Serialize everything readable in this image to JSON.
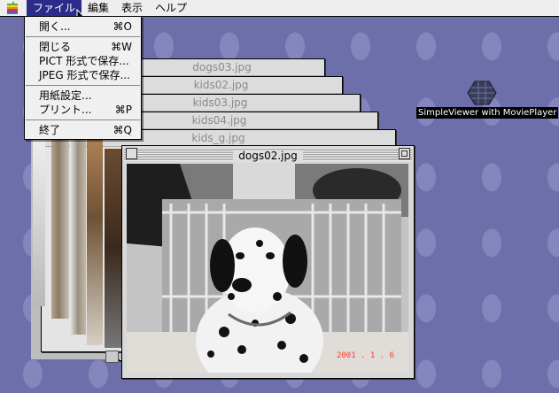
{
  "menubar": {
    "items": [
      "ファイル",
      "編集",
      "表示",
      "ヘルプ"
    ]
  },
  "file_menu": {
    "items": [
      {
        "label": "開く...",
        "shortcut": "⌘O"
      },
      {
        "label": "閉じる",
        "shortcut": "⌘W"
      },
      {
        "label": "PICT 形式で保存...",
        "shortcut": ""
      },
      {
        "label": "JPEG 形式で保存...",
        "shortcut": ""
      },
      {
        "label": "用紙設定...",
        "shortcut": ""
      },
      {
        "label": "プリント...",
        "shortcut": "⌘P"
      },
      {
        "label": "終了",
        "shortcut": "⌘Q"
      }
    ]
  },
  "stacked_windows": [
    "dogs03.jpg",
    "kids02.jpg",
    "kids03.jpg",
    "kids04.jpg",
    "kids_g.jpg"
  ],
  "front_window": {
    "title": "dogs02.jpg",
    "photo_date": "2001 . 1 . 6"
  },
  "desktop_icon": {
    "label": "SimpleViewer with MoviePlayer"
  }
}
